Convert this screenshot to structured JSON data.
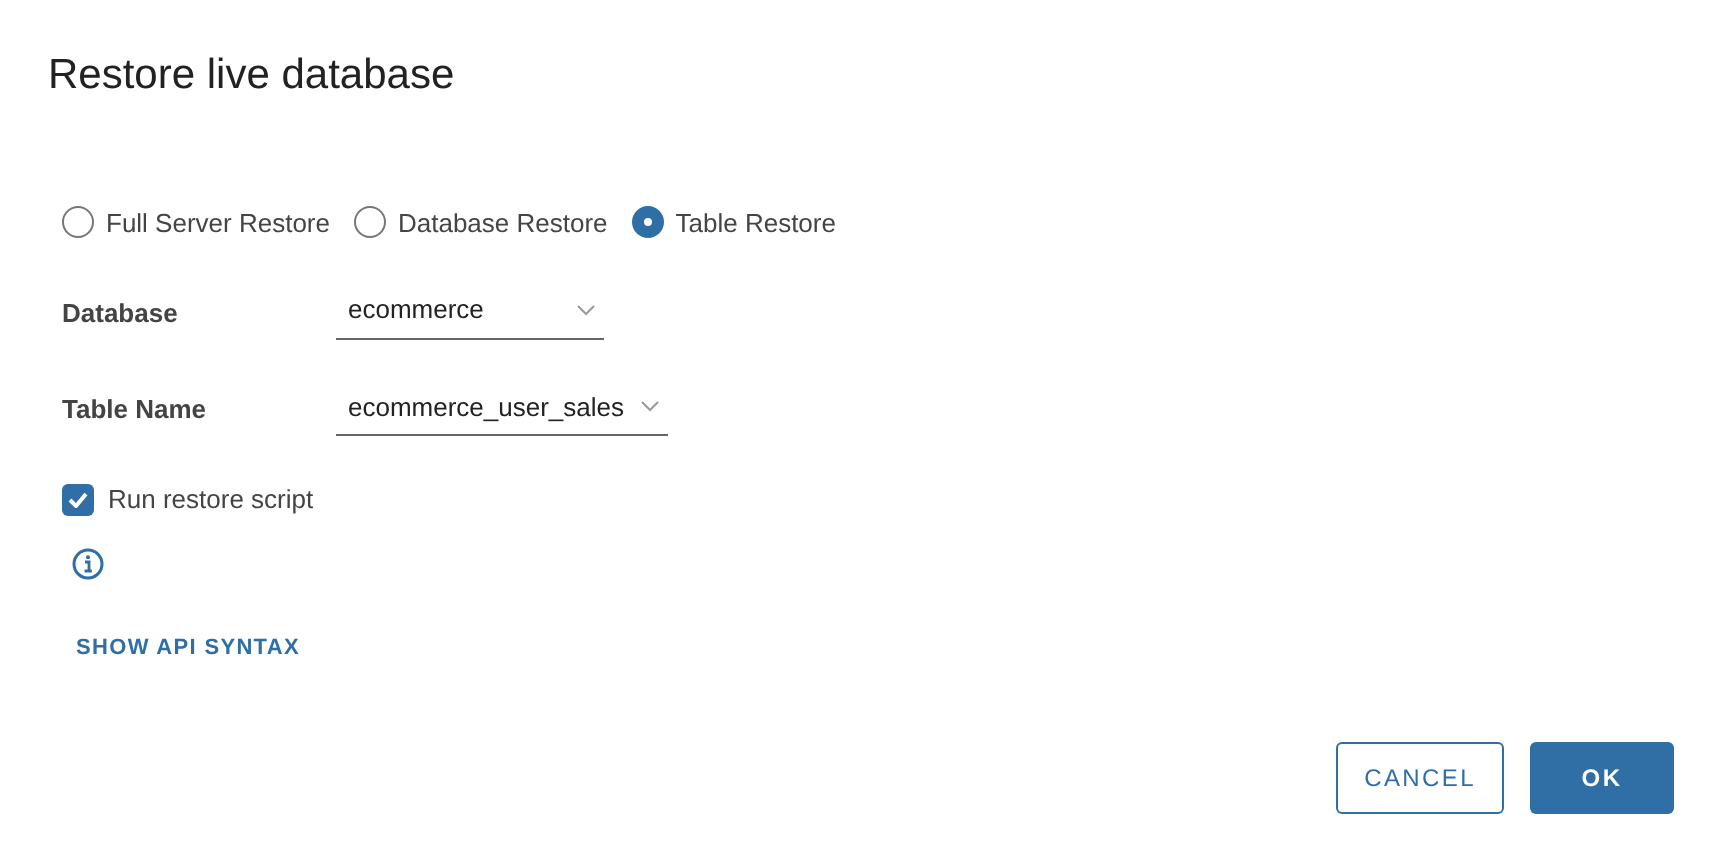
{
  "dialog": {
    "title": "Restore live database"
  },
  "restore_types": [
    {
      "label": "Full Server Restore",
      "selected": false
    },
    {
      "label": "Database Restore",
      "selected": false
    },
    {
      "label": "Table Restore",
      "selected": true
    }
  ],
  "fields": [
    {
      "label": "Database",
      "value": "ecommerce"
    },
    {
      "label": "Table Name",
      "value": "ecommerce_user_sales"
    }
  ],
  "run_restore_script": {
    "label": "Run restore script",
    "checked": true
  },
  "link": "SHOW API SYNTAX",
  "buttons": [
    {
      "label": "CANCEL",
      "kind": "secondary"
    },
    {
      "label": "OK",
      "kind": "primary"
    }
  ]
}
